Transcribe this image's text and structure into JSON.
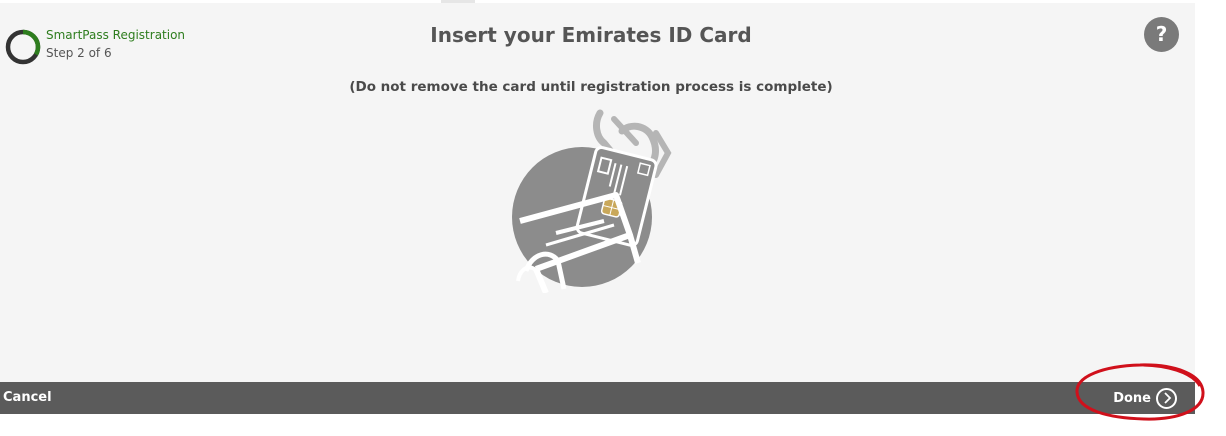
{
  "header": {
    "registration_title": "SmartPass Registration",
    "step_text": "Step 2 of 6",
    "step_progress": 0.333,
    "page_title": "Insert your Emirates ID Card",
    "help_label": "?"
  },
  "main": {
    "subtitle": "(Do not remove the card until registration process is complete)",
    "illustration": "card-insert-reader-icon"
  },
  "footer": {
    "cancel_label": "Cancel",
    "done_label": "Done",
    "done_icon": "chevron-right-circle-icon"
  },
  "colors": {
    "accent_green": "#2e7d1e",
    "footer_bg": "#5b5b5b",
    "panel_bg": "#f5f5f5",
    "annotation_red": "#d0101b"
  }
}
